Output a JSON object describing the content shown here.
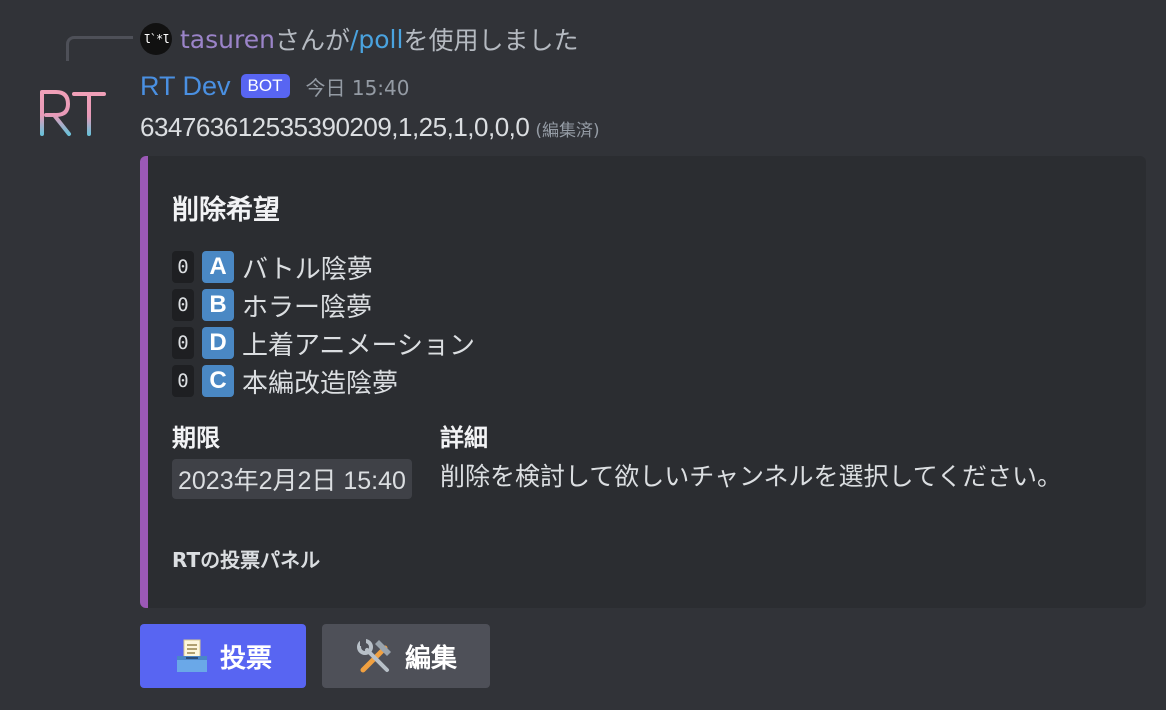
{
  "reply": {
    "avatar_text": "Ɩ`*Ɩ",
    "username": "tasuren",
    "text_before": "さんが",
    "command": "/poll",
    "text_after": "を使用しました"
  },
  "author": {
    "name": "RT Dev",
    "tag": "BOT",
    "timestamp": "今日 15:40",
    "avatar_text": "RT"
  },
  "content": {
    "text": "634763612535390209,1,25,1,0,0,0",
    "edited": "(編集済)"
  },
  "embed": {
    "color": "#9b59b6",
    "title": "削除希望",
    "options": [
      {
        "count": "0",
        "letter": "A",
        "label": "バトル陰夢"
      },
      {
        "count": "0",
        "letter": "B",
        "label": "ホラー陰夢"
      },
      {
        "count": "0",
        "letter": "D",
        "label": "上着アニメーション"
      },
      {
        "count": "0",
        "letter": "C",
        "label": "本編改造陰夢"
      }
    ],
    "fields": {
      "deadline_name": "期限",
      "deadline_value": "2023年2月2日 15:40",
      "detail_name": "詳細",
      "detail_value": "削除を検討して欲しいチャンネルを選択してください。"
    },
    "footer": "RTの投票パネル"
  },
  "buttons": {
    "vote": {
      "icon": "ballot-box-icon",
      "label": "投票",
      "color": "#5865f2"
    },
    "edit": {
      "icon": "hammer-wrench-icon",
      "label": "編集",
      "color": "#4e5058"
    }
  }
}
